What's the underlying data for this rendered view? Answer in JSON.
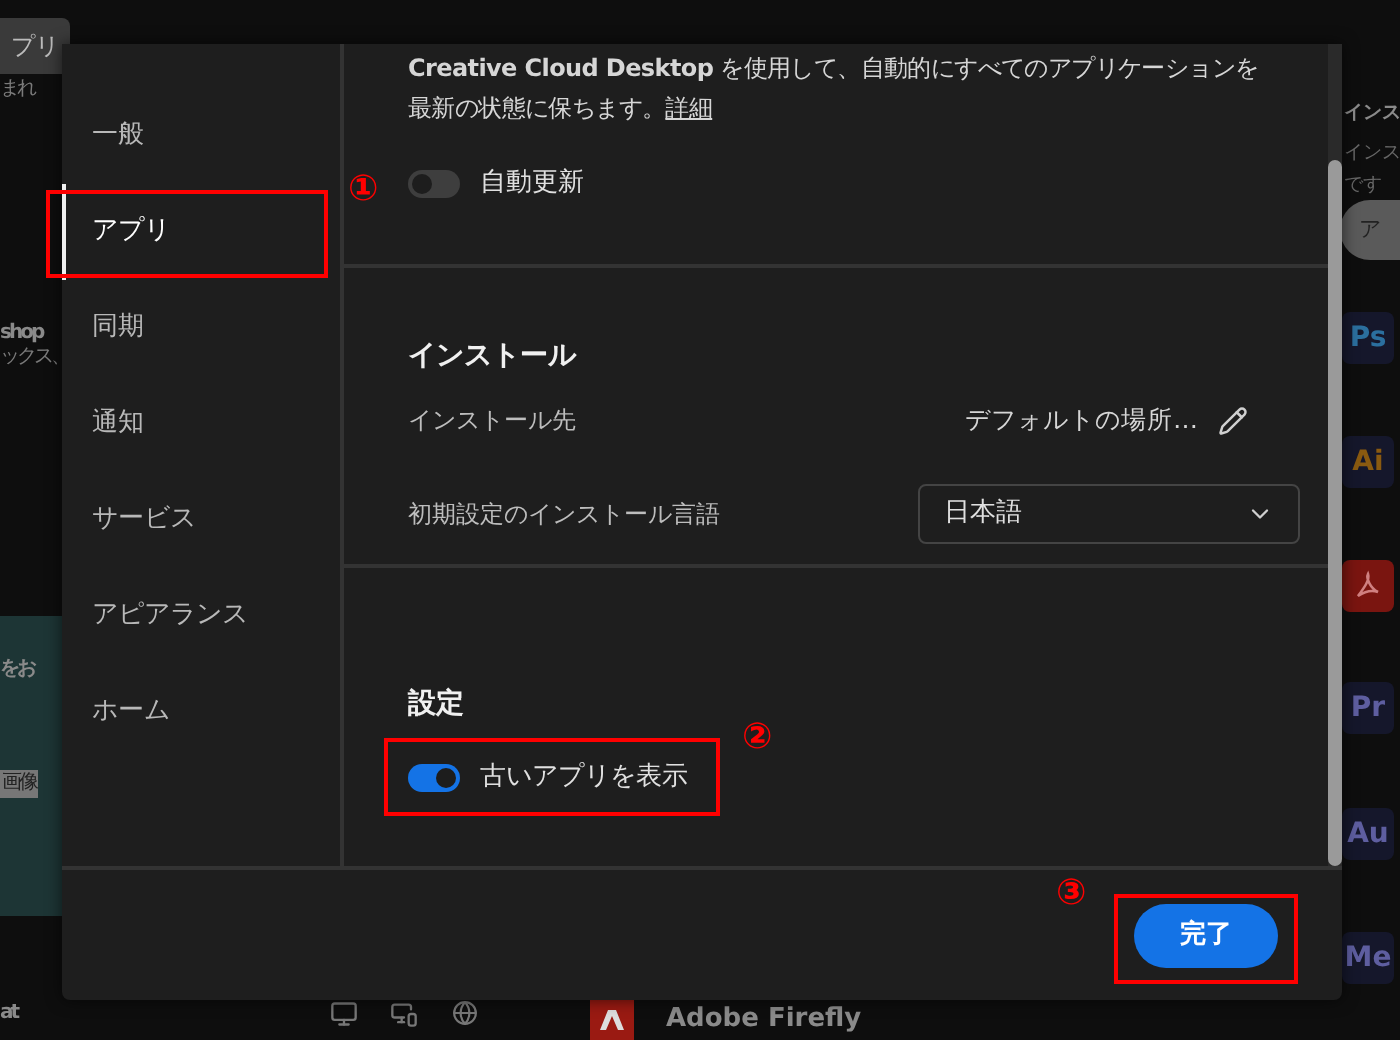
{
  "background": {
    "top_tab": "プリ",
    "left_texts": [
      {
        "text": "まれ",
        "kind": "plain"
      },
      {
        "text": "shop",
        "kind": "bold"
      },
      {
        "text": "ックス、",
        "kind": "plain"
      },
      {
        "text": "をお",
        "kind": "bold"
      },
      {
        "text": "画像",
        "kind": "chip"
      },
      {
        "text": "at",
        "kind": "bold"
      }
    ],
    "right_texts": [
      "インス",
      "インス",
      "です"
    ],
    "right_chip": "ア",
    "app_icons": [
      {
        "kind": "text",
        "label": "Ps",
        "color": "#2b6f9e"
      },
      {
        "kind": "text",
        "label": "Ai",
        "color": "#8a5a10"
      },
      {
        "kind": "acrobat",
        "color": "#7a1510"
      },
      {
        "kind": "text",
        "label": "Pr",
        "color": "#5e5ea0"
      },
      {
        "kind": "text",
        "label": "Au",
        "color": "#5e5ea0"
      },
      {
        "kind": "text",
        "label": "Me",
        "color": "#5e5ea0"
      }
    ],
    "bottom_app": "Adobe Firefly"
  },
  "dialog": {
    "sidebar": [
      {
        "label": "一般",
        "selected": false
      },
      {
        "label": "アプリ",
        "selected": true
      },
      {
        "label": "同期",
        "selected": false
      },
      {
        "label": "通知",
        "selected": false
      },
      {
        "label": "サービス",
        "selected": false
      },
      {
        "label": "アピアランス",
        "selected": false
      },
      {
        "label": "ホーム",
        "selected": false
      }
    ],
    "auto_update": {
      "description": "**Creative Cloud Desktop** を使用して、自動的にすべてのアプリケーションを最新の状態に保ちます。",
      "link": "詳細",
      "toggle": {
        "label": "自動更新",
        "on": false
      }
    },
    "install": {
      "heading": "インストール",
      "location": {
        "label": "インストール先",
        "value": "デフォルトの場所…"
      },
      "language": {
        "label": "初期設定のインストール言語",
        "value": "日本語"
      }
    },
    "settings": {
      "heading": "設定",
      "toggle": {
        "label": "古いアプリを表示",
        "on": true
      }
    },
    "done_button": "完了"
  },
  "annotations": [
    "①",
    "②",
    "③"
  ]
}
